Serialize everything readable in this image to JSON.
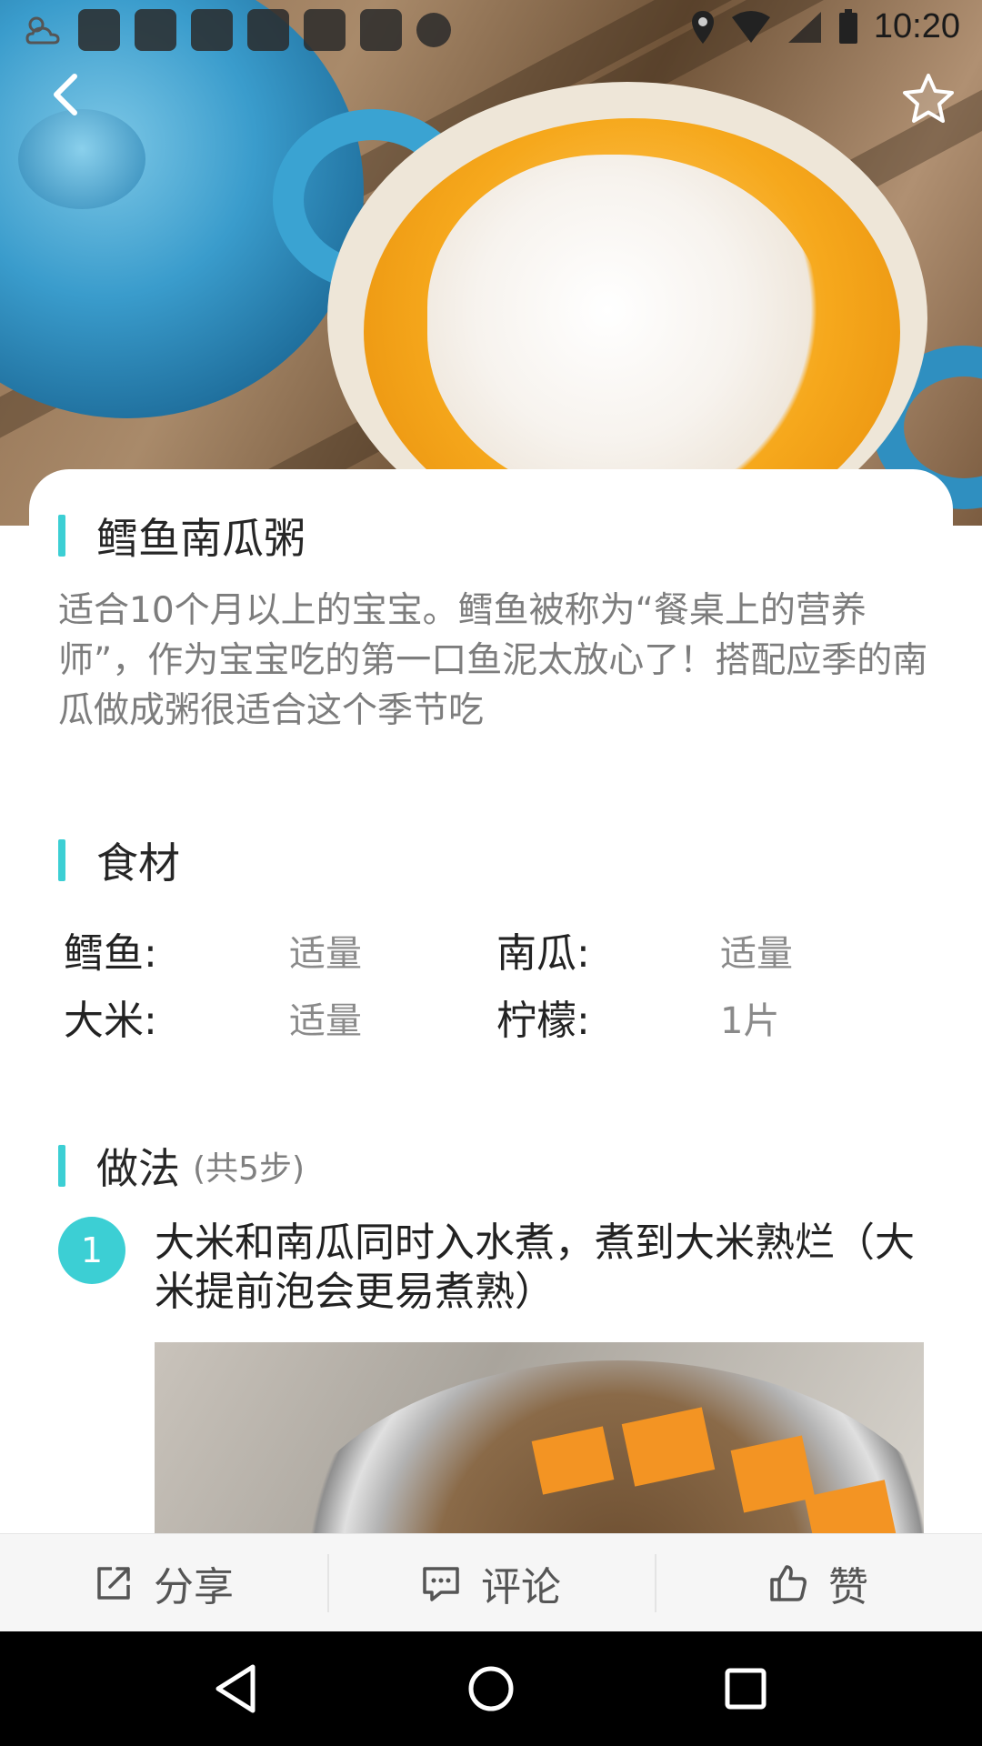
{
  "status_bar": {
    "time": "10:20"
  },
  "recipe": {
    "title": "鳕鱼南瓜粥",
    "description": "适合10个月以上的宝宝。鳕鱼被称为“餐桌上的营养师”，作为宝宝吃的第一口鱼泥太放心了！搭配应季的南瓜做成粥很适合这个季节吃"
  },
  "ingredients": {
    "title": "食材",
    "items": [
      {
        "name": "鳕鱼:",
        "amount": "适量"
      },
      {
        "name": "南瓜:",
        "amount": "适量"
      },
      {
        "name": "大米:",
        "amount": "适量"
      },
      {
        "name": "柠檬:",
        "amount": "1片"
      }
    ]
  },
  "method": {
    "title": "做法",
    "subtitle": "(共5步)",
    "steps": [
      {
        "number": "1",
        "text": "大米和南瓜同时入水煮，煮到大米熟烂（大米提前泡会更易煮熟）"
      }
    ]
  },
  "actions": {
    "share": "分享",
    "comment": "评论",
    "like": "赞"
  },
  "icons": {
    "back": "back-arrow-icon",
    "favorite": "star-icon",
    "share": "share-icon",
    "comment": "comment-icon",
    "like": "thumbs-up-icon",
    "nav_back": "triangle-back-icon",
    "nav_home": "circle-home-icon",
    "nav_recents": "square-recents-icon"
  },
  "colors": {
    "accent": "#3ccfd4"
  }
}
